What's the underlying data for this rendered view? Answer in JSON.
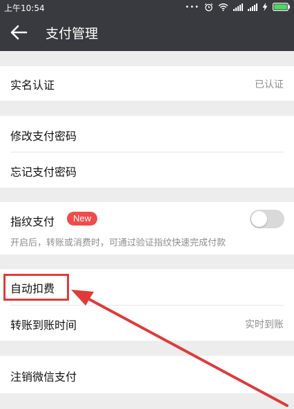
{
  "status_bar": {
    "time": "上午10:54",
    "dots": "•••",
    "icons": [
      "alarm-icon",
      "wifi-icon",
      "signal-icon",
      "signal-icon",
      "charging-icon",
      "battery-icon"
    ]
  },
  "header": {
    "title": "支付管理",
    "back_icon": "arrow-left-icon"
  },
  "sections": {
    "verify": {
      "label": "实名认证",
      "value": "已认证"
    },
    "password": {
      "change_label": "修改支付密码",
      "forgot_label": "忘记支付密码"
    },
    "fingerprint": {
      "label": "指纹支付",
      "badge": "New",
      "toggle_on": false,
      "description": "开启后，转账或消费时，可通过验证指纹快速完成付款"
    },
    "auto": {
      "label": "自动扣费",
      "transfer_label": "转账到账时间",
      "transfer_value": "实时到账"
    },
    "cancel": {
      "label": "注销微信支付"
    }
  },
  "colors": {
    "header_bg": "#393a3f",
    "page_bg": "#ededed",
    "badge": "#f24b4b",
    "annotation": "#e03a3a"
  }
}
